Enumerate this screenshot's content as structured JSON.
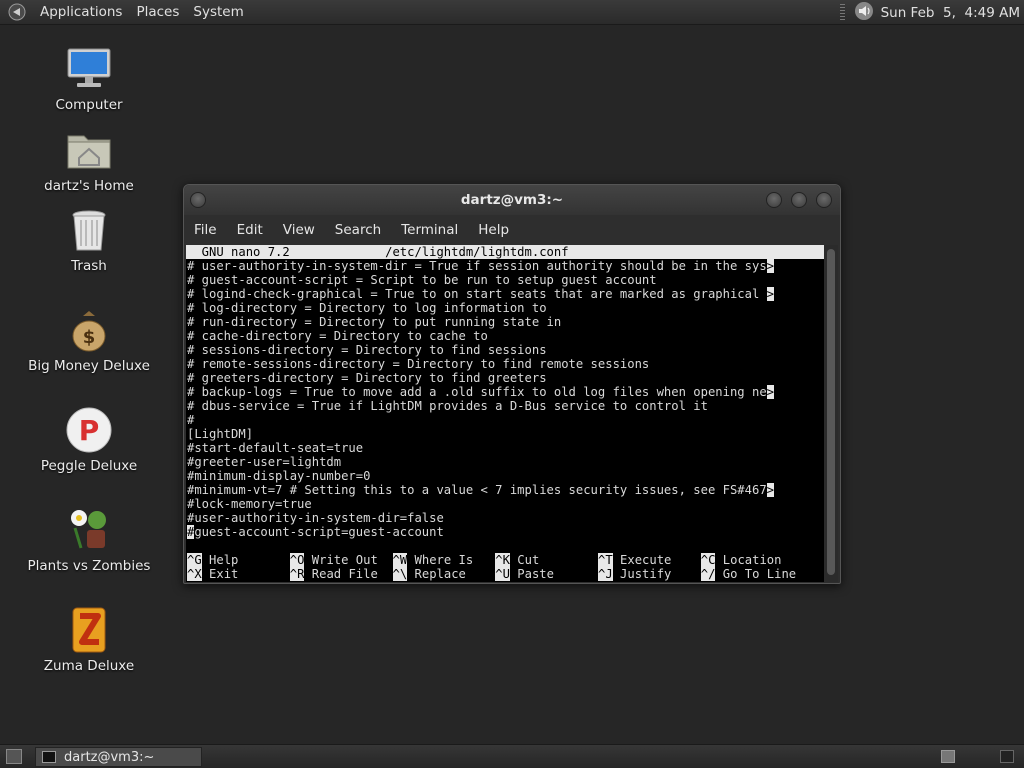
{
  "top_panel": {
    "menus": [
      "Applications",
      "Places",
      "System"
    ],
    "clock": "Sun Feb  5,  4:49 AM"
  },
  "desktop_icons": [
    {
      "label": "Computer",
      "icon": "computer-icon"
    },
    {
      "label": "dartz's Home",
      "icon": "home-folder-icon"
    },
    {
      "label": "Trash",
      "icon": "trash-icon"
    },
    {
      "label": "Big Money Deluxe",
      "icon": "money-bag-icon"
    },
    {
      "label": "Peggle Deluxe",
      "icon": "peggle-icon"
    },
    {
      "label": "Plants vs Zombies",
      "icon": "plants-vs-zombies-icon"
    },
    {
      "label": "Zuma Deluxe",
      "icon": "zuma-icon"
    }
  ],
  "terminal": {
    "title": "dartz@vm3:~",
    "menu": [
      "File",
      "Edit",
      "View",
      "Search",
      "Terminal",
      "Help"
    ],
    "nano_header": "  GNU nano 7.2             /etc/lightdm/lightdm.conf",
    "lines": [
      "# user-authority-in-system-dir = True if session authority should be in the sys",
      "# guest-account-script = Script to be run to setup guest account",
      "# logind-check-graphical = True to on start seats that are marked as graphical ",
      "# log-directory = Directory to log information to",
      "# run-directory = Directory to put running state in",
      "# cache-directory = Directory to cache to",
      "# sessions-directory = Directory to find sessions",
      "# remote-sessions-directory = Directory to find remote sessions",
      "# greeters-directory = Directory to find greeters",
      "# backup-logs = True to move add a .old suffix to old log files when opening ne",
      "# dbus-service = True if LightDM provides a D-Bus service to control it",
      "#",
      "[LightDM]",
      "#start-default-seat=true",
      "#greeter-user=lightdm",
      "#minimum-display-number=0",
      "#minimum-vt=7 # Setting this to a value < 7 implies security issues, see FS#467",
      "#lock-memory=true",
      "#user-authority-in-system-dir=false",
      "#guest-account-script=guest-account"
    ],
    "overflow_marks": [
      0,
      2,
      9,
      16
    ],
    "shortcuts_row1": [
      {
        "key": "^G",
        "label": "Help"
      },
      {
        "key": "^O",
        "label": "Write Out"
      },
      {
        "key": "^W",
        "label": "Where Is"
      },
      {
        "key": "^K",
        "label": "Cut"
      },
      {
        "key": "^T",
        "label": "Execute"
      },
      {
        "key": "^C",
        "label": "Location"
      }
    ],
    "shortcuts_row2": [
      {
        "key": "^X",
        "label": "Exit"
      },
      {
        "key": "^R",
        "label": "Read File"
      },
      {
        "key": "^\\",
        "label": "Replace"
      },
      {
        "key": "^U",
        "label": "Paste"
      },
      {
        "key": "^J",
        "label": "Justify"
      },
      {
        "key": "^/",
        "label": "Go To Line"
      }
    ]
  },
  "taskbar": {
    "task_label": "dartz@vm3:~"
  }
}
